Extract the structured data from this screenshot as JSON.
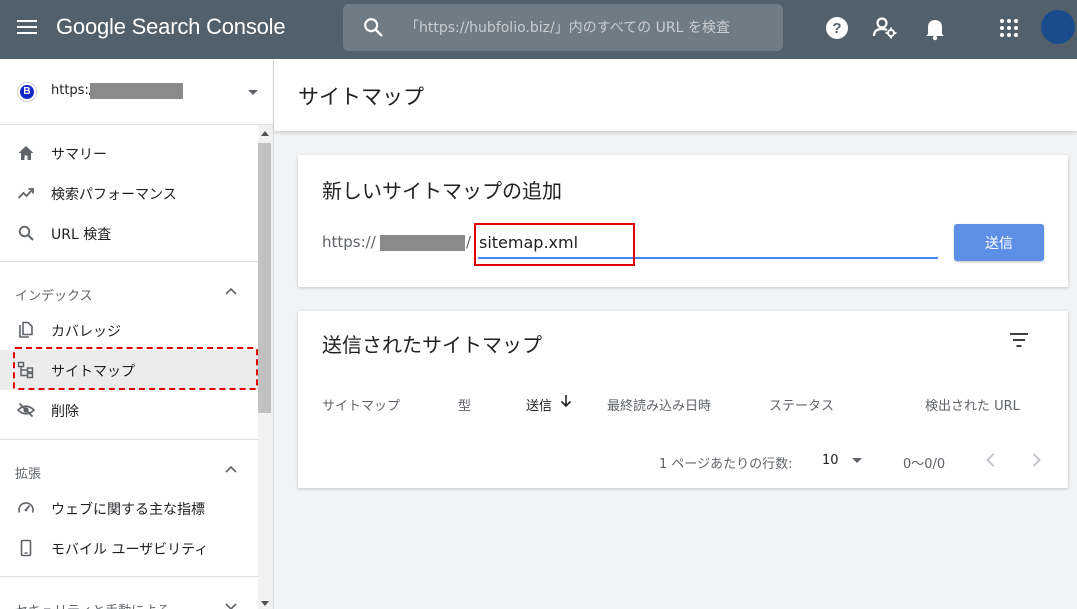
{
  "app": {
    "title": "Google Search Console"
  },
  "search": {
    "placeholder": "「https://hubfolio.biz/」内のすべての URL を検査"
  },
  "property": {
    "url_prefix": "https://",
    "badge_letter": "B"
  },
  "sidebar": {
    "items_top": [
      {
        "label": "サマリー",
        "icon": "home-icon"
      },
      {
        "label": "検索パフォーマンス",
        "icon": "trending-up-icon"
      },
      {
        "label": "URL 検査",
        "icon": "search-icon"
      }
    ],
    "sections": [
      {
        "label": "インデックス",
        "expanded": true
      },
      {
        "label": "拡張",
        "expanded": true
      },
      {
        "label": "セキュリティと手動による",
        "expanded": false
      }
    ],
    "index_items": [
      {
        "label": "カバレッジ",
        "icon": "copy-icon"
      },
      {
        "label": "サイトマップ",
        "icon": "sitemap-icon",
        "active": true
      },
      {
        "label": "削除",
        "icon": "visibility-off-icon"
      }
    ],
    "enhancement_items": [
      {
        "label": "ウェブに関する主な指標",
        "icon": "speed-icon"
      },
      {
        "label": "モバイル ユーザビリティ",
        "icon": "smartphone-icon"
      }
    ]
  },
  "page": {
    "title": "サイトマップ"
  },
  "add_sitemap": {
    "title": "新しいサイトマップの追加",
    "prefix": "https://",
    "slash": "/",
    "input_value": "sitemap.xml",
    "submit_label": "送信"
  },
  "submitted": {
    "title": "送信されたサイトマップ",
    "columns": [
      "サイトマップ",
      "型",
      "送信",
      "最終読み込み日時",
      "ステータス",
      "検出された URL"
    ],
    "sorted_column": "送信",
    "rows_per_page_label": "1 ページあたりの行数:",
    "rows_per_page": "10",
    "range": "0〜0/0"
  },
  "colors": {
    "topbar": "#52606b",
    "accent": "#4285f4",
    "button": "#5d8fe6",
    "highlight": "#e00000"
  }
}
